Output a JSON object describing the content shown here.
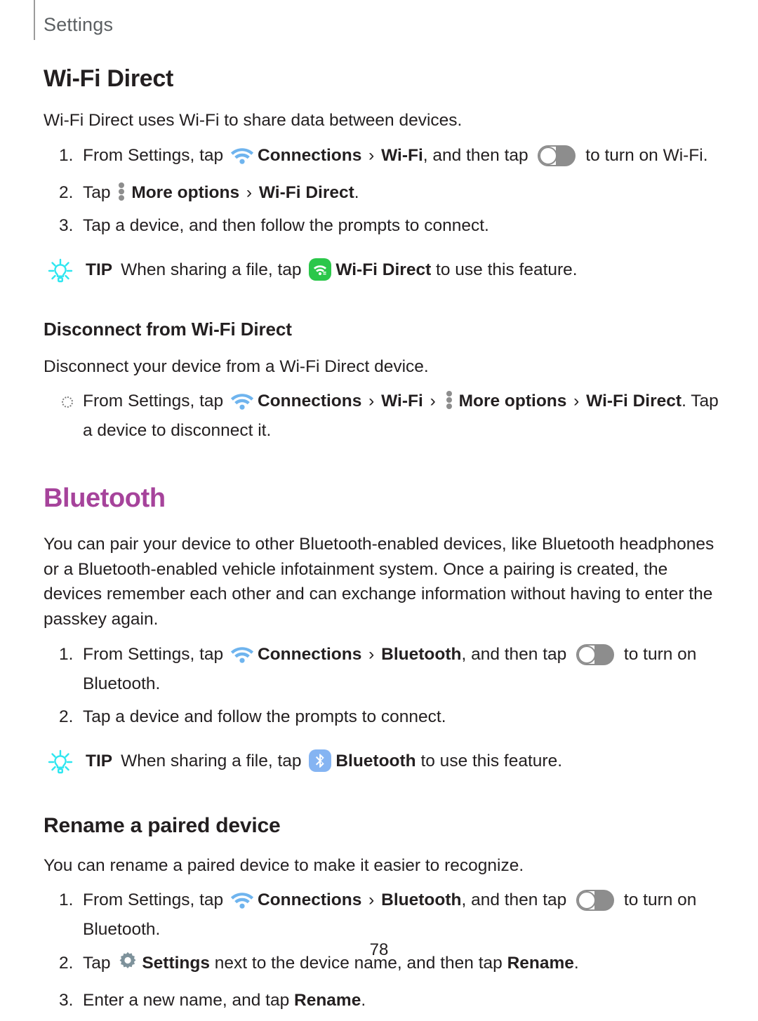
{
  "running_header": {
    "label": "Settings"
  },
  "page": {
    "folio": "78"
  },
  "colors": {
    "section_heading": "#a6439b",
    "wifi_icon": "#6fb4ee",
    "wifi_direct_badge": "#2bc74a",
    "bluetooth_badge": "#85b4f2",
    "tip_bulb": "#2ee6f0",
    "gear_icon": "#7e929b",
    "toggle_track": "#8d8d8d",
    "dots_icon": "#8d8d8d",
    "body_text": "#231f20",
    "header_text": "#5c6063"
  },
  "sections": {
    "wifi_direct": {
      "heading": "Wi-Fi Direct",
      "intro": "Wi-Fi Direct uses Wi-Fi to share data between devices.",
      "steps": [
        {
          "num": "1.",
          "parts": [
            {
              "t": "text",
              "v": "From Settings, tap "
            },
            {
              "t": "icon",
              "name": "wifi-icon"
            },
            {
              "t": "bold",
              "v": "Connections"
            },
            {
              "t": "sep",
              "v": " › "
            },
            {
              "t": "bold",
              "v": "Wi-Fi"
            },
            {
              "t": "text",
              "v": ", and then tap "
            },
            {
              "t": "icon",
              "name": "toggle-switch-icon"
            },
            {
              "t": "text",
              "v": " to turn on Wi-Fi."
            }
          ]
        },
        {
          "num": "2.",
          "parts": [
            {
              "t": "text",
              "v": "Tap "
            },
            {
              "t": "icon",
              "name": "more-options-icon"
            },
            {
              "t": "bold",
              "v": "More options"
            },
            {
              "t": "sep",
              "v": " › "
            },
            {
              "t": "bold",
              "v": "Wi-Fi Direct"
            },
            {
              "t": "text",
              "v": "."
            }
          ]
        },
        {
          "num": "3.",
          "parts": [
            {
              "t": "text",
              "v": "Tap a device, and then follow the prompts to connect."
            }
          ]
        }
      ],
      "tip": {
        "word": "TIP",
        "before": "When sharing a file, tap ",
        "bold": "Wi-Fi Direct",
        "after": " to use this feature.",
        "icon": "wifi-direct-badge-icon"
      }
    },
    "disconnect": {
      "heading": "Disconnect from Wi-Fi Direct",
      "intro": "Disconnect your device from a Wi-Fi Direct device.",
      "bullets": [
        {
          "parts": [
            {
              "t": "text",
              "v": "From Settings, tap "
            },
            {
              "t": "icon",
              "name": "wifi-icon"
            },
            {
              "t": "bold",
              "v": "Connections"
            },
            {
              "t": "sep",
              "v": " › "
            },
            {
              "t": "bold",
              "v": "Wi-Fi"
            },
            {
              "t": "sep",
              "v": " › "
            },
            {
              "t": "icon",
              "name": "more-options-icon"
            },
            {
              "t": "bold",
              "v": "More options"
            },
            {
              "t": "sep",
              "v": " › "
            },
            {
              "t": "bold",
              "v": "Wi-Fi Direct"
            },
            {
              "t": "text",
              "v": ". Tap a device to disconnect it."
            }
          ]
        }
      ]
    },
    "bluetooth": {
      "heading": "Bluetooth",
      "intro": "You can pair your device to other Bluetooth-enabled devices, like Bluetooth headphones or a Bluetooth-enabled vehicle infotainment system. Once a pairing is created, the devices remember each other and can exchange information without having to enter the passkey again.",
      "steps": [
        {
          "num": "1.",
          "parts": [
            {
              "t": "text",
              "v": "From Settings, tap "
            },
            {
              "t": "icon",
              "name": "wifi-icon"
            },
            {
              "t": "bold",
              "v": "Connections"
            },
            {
              "t": "sep",
              "v": " › "
            },
            {
              "t": "bold",
              "v": "Bluetooth"
            },
            {
              "t": "text",
              "v": ", and then tap "
            },
            {
              "t": "icon",
              "name": "toggle-switch-icon"
            },
            {
              "t": "text",
              "v": " to turn on Bluetooth."
            }
          ]
        },
        {
          "num": "2.",
          "parts": [
            {
              "t": "text",
              "v": "Tap a device and follow the prompts to connect."
            }
          ]
        }
      ],
      "tip": {
        "word": "TIP",
        "before": "When sharing a file, tap ",
        "bold": "Bluetooth",
        "after": " to use this feature.",
        "icon": "bluetooth-badge-icon"
      }
    },
    "rename": {
      "heading": "Rename a paired device",
      "intro": "You can rename a paired device to make it easier to recognize.",
      "steps": [
        {
          "num": "1.",
          "parts": [
            {
              "t": "text",
              "v": "From Settings, tap "
            },
            {
              "t": "icon",
              "name": "wifi-icon"
            },
            {
              "t": "bold",
              "v": "Connections"
            },
            {
              "t": "sep",
              "v": " › "
            },
            {
              "t": "bold",
              "v": "Bluetooth"
            },
            {
              "t": "text",
              "v": ", and then tap "
            },
            {
              "t": "icon",
              "name": "toggle-switch-icon"
            },
            {
              "t": "text",
              "v": " to turn on Bluetooth."
            }
          ]
        },
        {
          "num": "2.",
          "parts": [
            {
              "t": "text",
              "v": "Tap "
            },
            {
              "t": "icon",
              "name": "gear-icon"
            },
            {
              "t": "bold",
              "v": "Settings"
            },
            {
              "t": "text",
              "v": " next to the device name, and then tap "
            },
            {
              "t": "bold",
              "v": "Rename"
            },
            {
              "t": "text",
              "v": "."
            }
          ]
        },
        {
          "num": "3.",
          "parts": [
            {
              "t": "text",
              "v": "Enter a new name, and tap "
            },
            {
              "t": "bold",
              "v": "Rename"
            },
            {
              "t": "text",
              "v": "."
            }
          ]
        }
      ]
    }
  }
}
